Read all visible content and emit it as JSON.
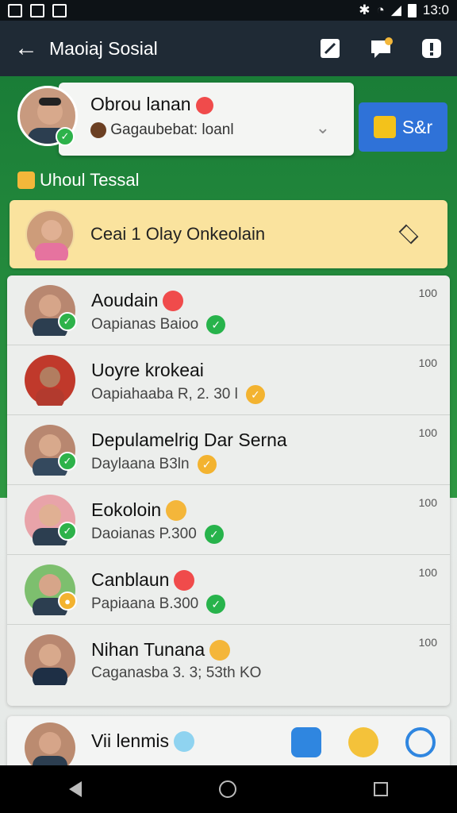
{
  "statusbar": {
    "time": "13:0"
  },
  "appbar": {
    "back_icon": "arrow-left",
    "title": "Maoiaj Sosial"
  },
  "profile": {
    "name": "Obrou lanan",
    "subtitle": "Gagaubebat: loanl"
  },
  "search_button": {
    "label": "S&r"
  },
  "section_label": "Uhoul Tessal",
  "featured": {
    "text": "Ceai 1 Olay Onkeolain"
  },
  "list": [
    {
      "name": "Aoudain",
      "sub": "Oapianas Baioo",
      "count": "100",
      "emoji": "red",
      "chip": "green"
    },
    {
      "name": "Uoyre krokeai",
      "sub": "Oapiahaaba R, 2. 30 l",
      "count": "100",
      "emoji": "",
      "chip": "gold"
    },
    {
      "name": "Depulamelrig Dar Serna",
      "sub": "Daylaana B3ln",
      "count": "100",
      "emoji": "",
      "chip": "gold"
    },
    {
      "name": "Eokoloin",
      "sub": "Daoianas P.300",
      "count": "100",
      "emoji": "gold",
      "chip": "green"
    },
    {
      "name": "Canblaun",
      "sub": "Papiaana B.300",
      "count": "100",
      "emoji": "red",
      "chip": "green"
    },
    {
      "name": "Nihan Tunana",
      "sub": "Caganasba 3. 3; 53th KO",
      "count": "100",
      "emoji": "gold",
      "chip": ""
    }
  ],
  "bottom_card": {
    "name": "Vii lenmis"
  }
}
